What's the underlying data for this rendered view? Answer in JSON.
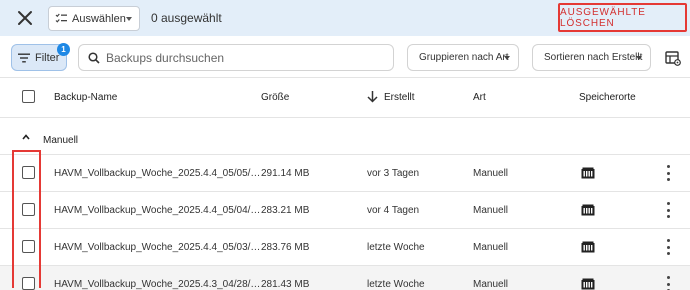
{
  "selection_bar": {
    "select_label": "Auswählen",
    "count_text": "0 ausgewählt",
    "delete_label": "AUSGEWÄHLTE LÖSCHEN"
  },
  "toolbar": {
    "filter_label": "Filter",
    "filter_count": "1",
    "search_placeholder": "Backups durchsuchen",
    "group_label": "Gruppieren nach Art",
    "sort_label": "Sortieren nach Erstellt"
  },
  "columns": {
    "name": "Backup-Name",
    "size": "Größe",
    "created": "Erstellt",
    "type": "Art",
    "locations": "Speicherorte"
  },
  "group": {
    "label": "Manuell"
  },
  "rows": [
    {
      "name": "HAVM_Vollbackup_Woche_2025.4.4_05/05/…",
      "size": "291.14 MB",
      "created": "vor 3 Tagen",
      "type": "Manuell"
    },
    {
      "name": "HAVM_Vollbackup_Woche_2025.4.4_05/04/…",
      "size": "283.21 MB",
      "created": "vor 4 Tagen",
      "type": "Manuell"
    },
    {
      "name": "HAVM_Vollbackup_Woche_2025.4.4_05/03/…",
      "size": "283.76 MB",
      "created": "letzte Woche",
      "type": "Manuell"
    },
    {
      "name": "HAVM_Vollbackup_Woche_2025.4.3_04/28/…",
      "size": "281.43 MB",
      "created": "letzte Woche",
      "type": "Manuell"
    }
  ],
  "icons": {
    "close": "close-icon",
    "select": "checklist-icon",
    "filter": "filter-icon",
    "search": "search-icon",
    "settings": "table-settings-icon",
    "sort_dir": "arrow-down-icon",
    "group": "chevron-up-icon",
    "storage": "storage-device-icon",
    "row_menu": "more-vert-icon"
  },
  "colors": {
    "accent": "#1e88e5",
    "danger": "#d32f2f",
    "selection_bg": "#e3eef9",
    "filter_bg": "#dbe8f7"
  }
}
